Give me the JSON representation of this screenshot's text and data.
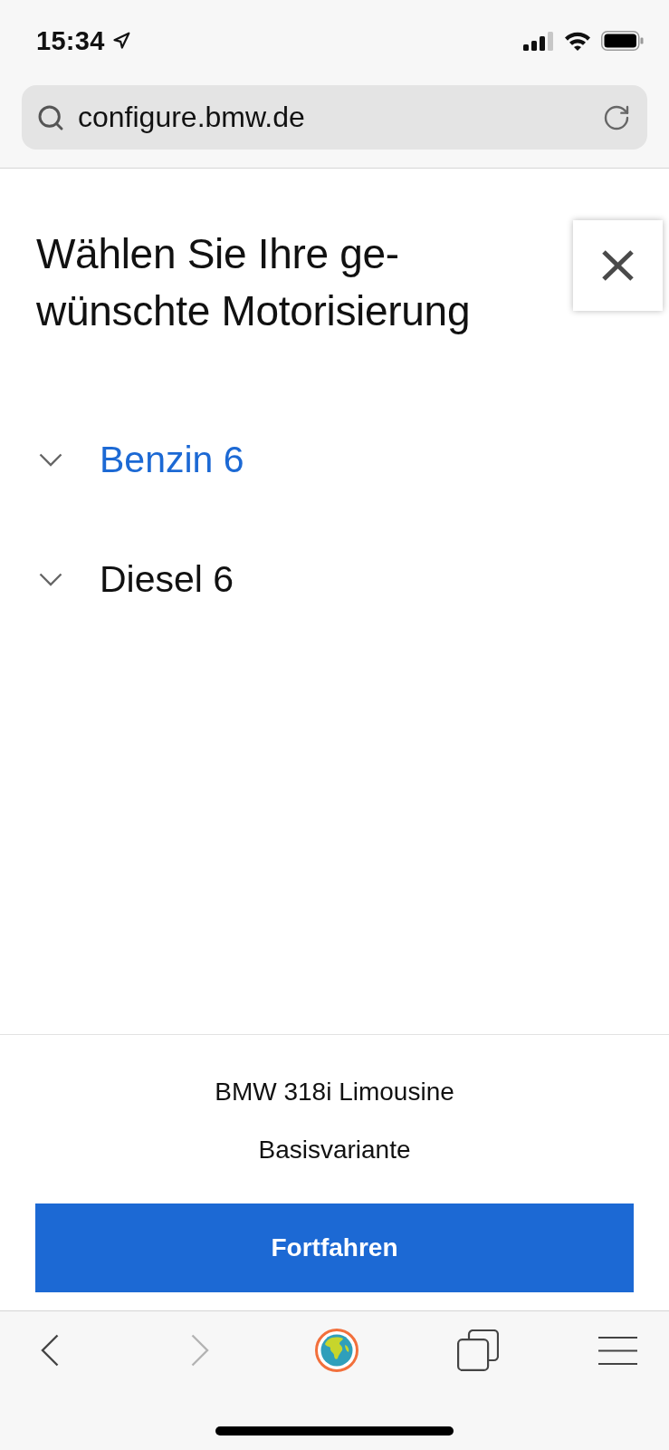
{
  "status_bar": {
    "time": "15:34"
  },
  "address_bar": {
    "url": "configure.bmw.de"
  },
  "dialog": {
    "title": "Wählen Sie Ihre ge-\nwünschte Motorisierung"
  },
  "engine_groups": [
    {
      "label": "Benzin 6",
      "selected": true,
      "expanded": false
    },
    {
      "label": "Diesel 6",
      "selected": false,
      "expanded": false
    }
  ],
  "summary": {
    "model": "BMW 318i Limousine",
    "variant": "Basisvariante",
    "continue_button": "Fortfahren"
  },
  "toolbar": {
    "back": {
      "disabled": false
    },
    "forward": {
      "disabled": true
    }
  }
}
